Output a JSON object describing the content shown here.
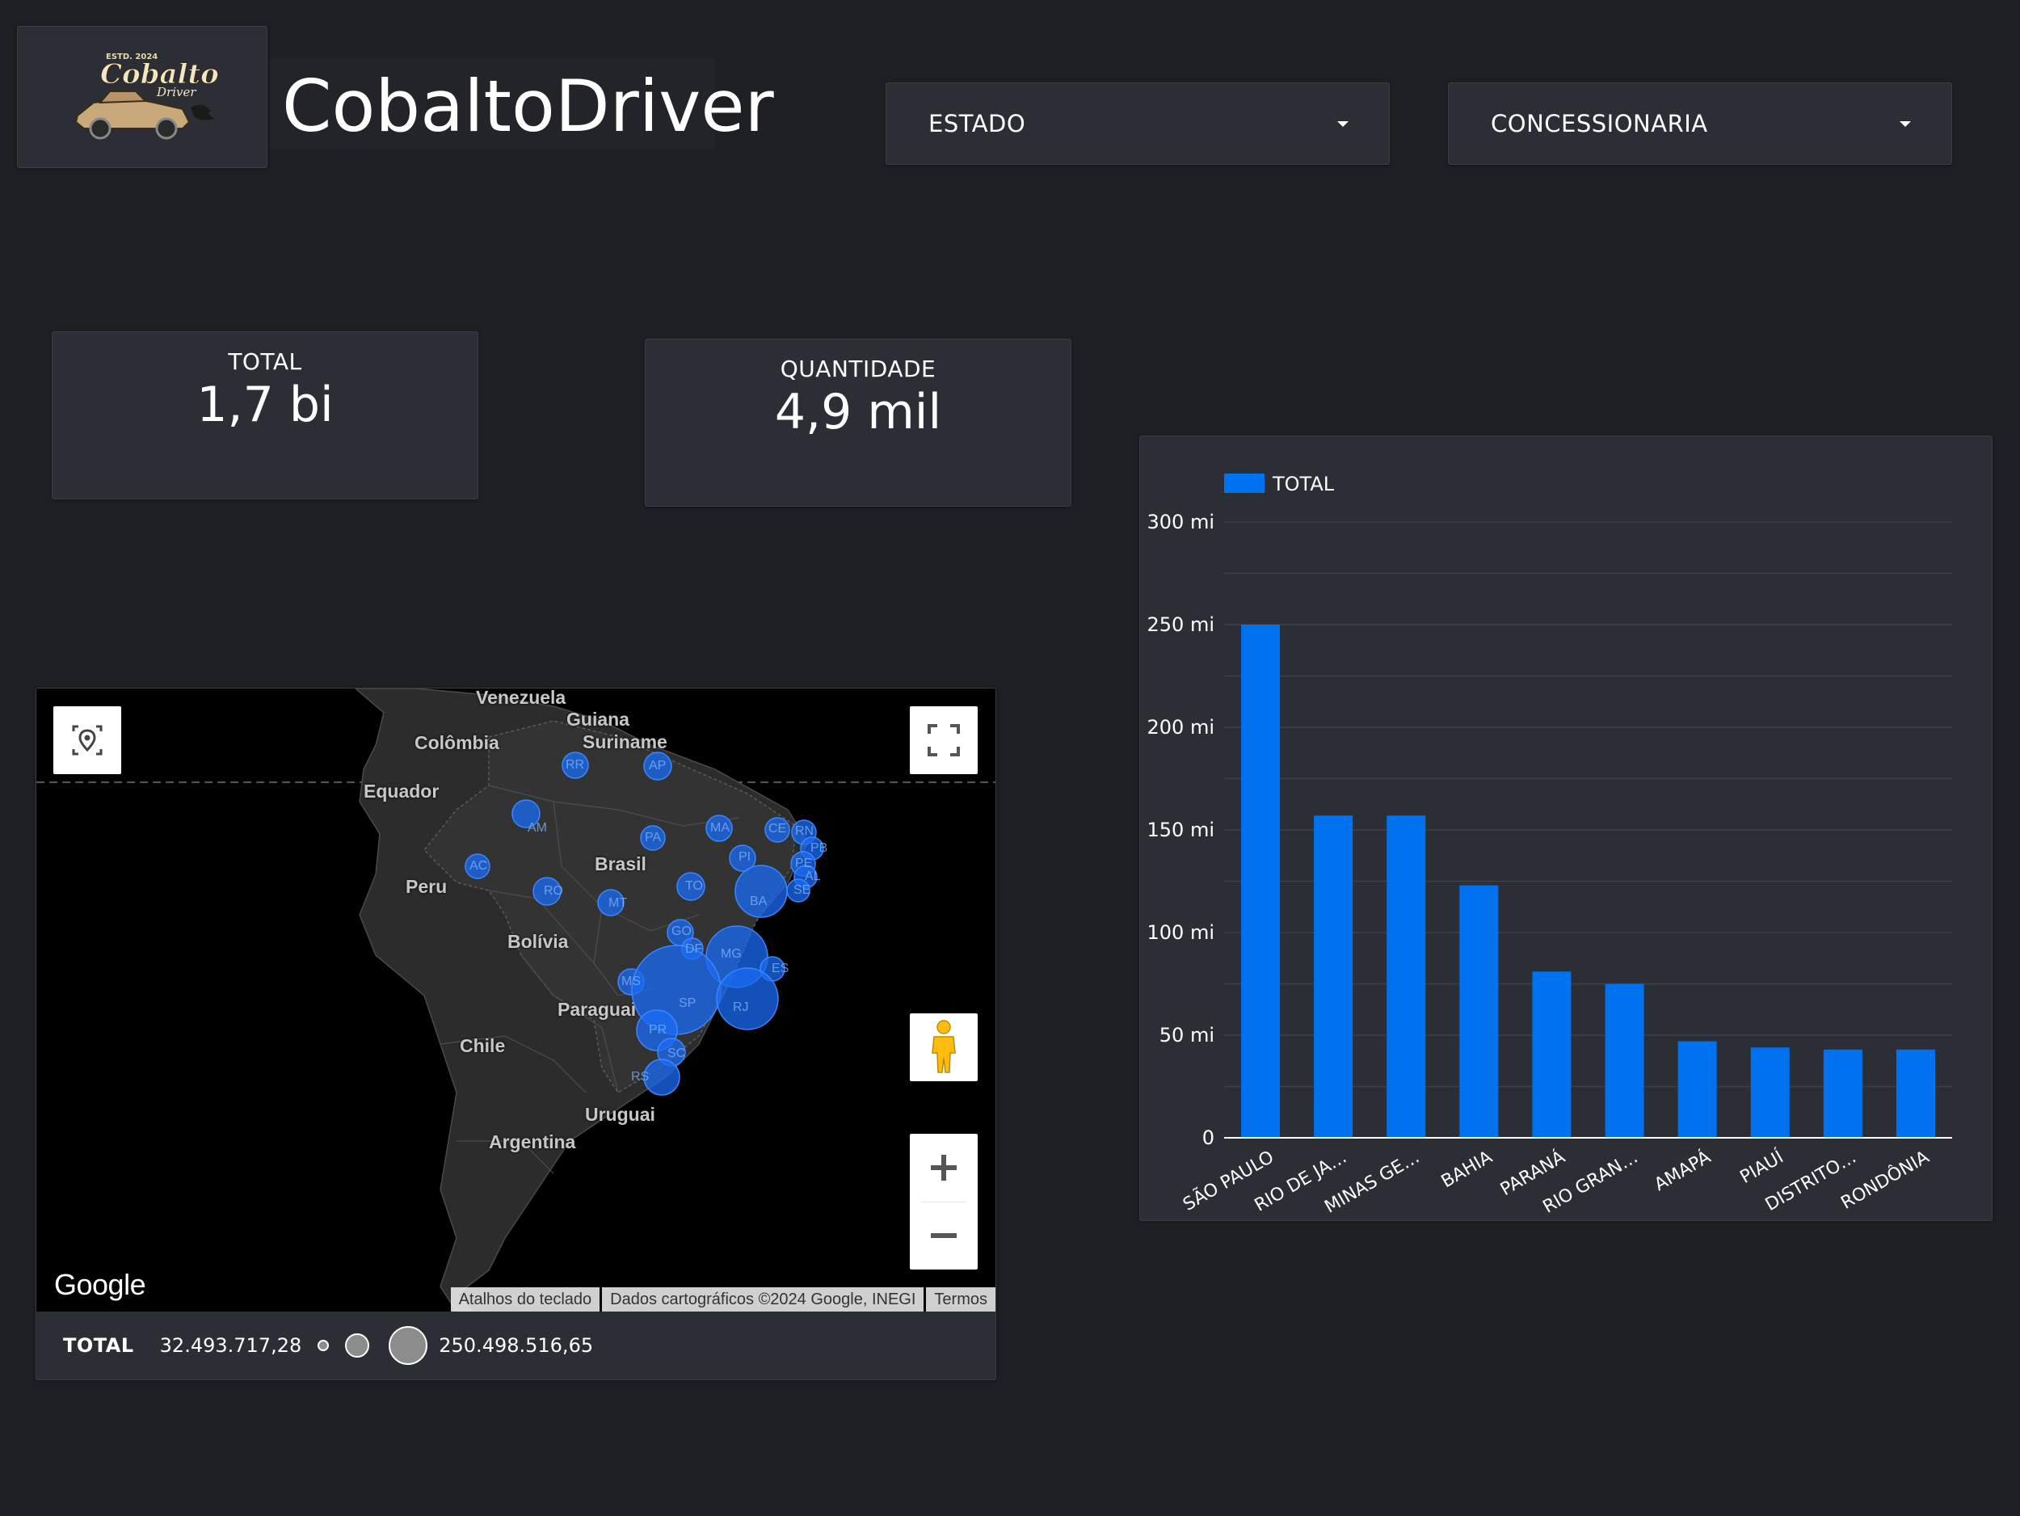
{
  "header": {
    "logo_top_text": "ESTD. 2024",
    "logo_main_text": "Cobalto",
    "logo_sub_text": "Driver",
    "app_title": "CobaltoDriver"
  },
  "filters": {
    "estado_label": "ESTADO",
    "concessionaria_label": "CONCESSIONARIA"
  },
  "kpis": {
    "total_label": "TOTAL",
    "total_value": "1,7 bi",
    "quantidade_label": "QUANTIDADE",
    "quantidade_value": "4,9 mil"
  },
  "map": {
    "country_labels": [
      "Venezuela",
      "Guiana",
      "Suriname",
      "Colômbia",
      "Equador",
      "Peru",
      "Brasil",
      "Bolívia",
      "Paraguai",
      "Chile",
      "Uruguai",
      "Argentina"
    ],
    "state_codes": [
      "RR",
      "AP",
      "AM",
      "PA",
      "MA",
      "CE",
      "RN",
      "PB",
      "PE",
      "AL",
      "SE",
      "PI",
      "AC",
      "RO",
      "MT",
      "TO",
      "BA",
      "GO",
      "DF",
      "MG",
      "ES",
      "MS",
      "SP",
      "RJ",
      "PR",
      "SC",
      "RS"
    ],
    "google_logo": "Google",
    "attribution": [
      "Atalhos do teclado",
      "Dados cartográficos ©2024 Google, INEGI",
      "Termos"
    ],
    "legend_title": "TOTAL",
    "legend_min": "32.493.717,28",
    "legend_max": "250.498.516,65",
    "bubble_color": "#1a6cf5"
  },
  "chart_data": {
    "type": "bar",
    "title": "",
    "legend": [
      "TOTAL"
    ],
    "legend_placement": "top-left",
    "categories": [
      "SÃO PAULO",
      "RIO DE JA…",
      "MINAS GE…",
      "BAHIA",
      "PARANÁ",
      "RIO GRAN…",
      "AMAPÁ",
      "PIAUÍ",
      "DISTRITO…",
      "RONDÔNIA"
    ],
    "series": [
      {
        "name": "TOTAL",
        "values": [
          250,
          157,
          157,
          123,
          81,
          75,
          47,
          44,
          43,
          43
        ]
      }
    ],
    "ylim": [
      0,
      300
    ],
    "yticks": [
      0,
      50,
      100,
      150,
      200,
      250,
      300
    ],
    "ytick_labels": [
      "0",
      "50 mi",
      "100 mi",
      "150 mi",
      "200 mi",
      "250 mi",
      "300 mi"
    ],
    "grid": true,
    "bar_color": "#0072f0"
  }
}
